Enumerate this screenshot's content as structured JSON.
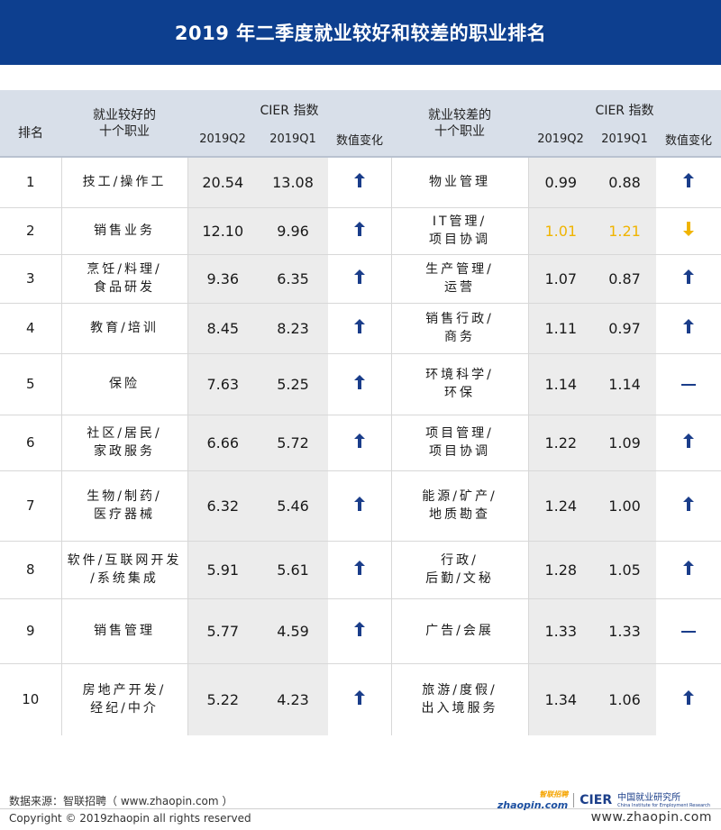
{
  "title": "2019 年二季度就业较好和较差的职业排名",
  "header": {
    "rank": "排名",
    "good_label_1": "就业较好的",
    "good_label_2": "十个职业",
    "bad_label_1": "就业较差的",
    "bad_label_2": "十个职业",
    "cier_index": "CIER 指数",
    "q2": "2019Q2",
    "q1": "2019Q1",
    "change": "数值变化"
  },
  "rows": [
    {
      "rank": "1",
      "good": [
        "技工/操作工"
      ],
      "good_q2": "20.54",
      "good_q1": "13.08",
      "good_change": "up",
      "bad": [
        "物业管理"
      ],
      "bad_q2": "0.99",
      "bad_q1": "0.88",
      "bad_change": "up"
    },
    {
      "rank": "2",
      "good": [
        "销售业务"
      ],
      "good_q2": "12.10",
      "good_q1": "9.96",
      "good_change": "up",
      "bad": [
        "IT管理/",
        "项目协调"
      ],
      "bad_q2": "1.01",
      "bad_q1": "1.21",
      "bad_change": "down"
    },
    {
      "rank": "3",
      "good": [
        "烹饪/料理/",
        "食品研发"
      ],
      "good_q2": "9.36",
      "good_q1": "6.35",
      "good_change": "up",
      "bad": [
        "生产管理/",
        "运营"
      ],
      "bad_q2": "1.07",
      "bad_q1": "0.87",
      "bad_change": "up"
    },
    {
      "rank": "4",
      "good": [
        "教育/培训"
      ],
      "good_q2": "8.45",
      "good_q1": "8.23",
      "good_change": "up",
      "bad": [
        "销售行政/",
        "商务"
      ],
      "bad_q2": "1.11",
      "bad_q1": "0.97",
      "bad_change": "up"
    },
    {
      "rank": "5",
      "good": [
        "保险"
      ],
      "good_q2": "7.63",
      "good_q1": "5.25",
      "good_change": "up",
      "bad": [
        "环境科学/",
        "环保"
      ],
      "bad_q2": "1.14",
      "bad_q1": "1.14",
      "bad_change": "flat"
    },
    {
      "rank": "6",
      "good": [
        "社区/居民/",
        "家政服务"
      ],
      "good_q2": "6.66",
      "good_q1": "5.72",
      "good_change": "up",
      "bad": [
        "项目管理/",
        "项目协调"
      ],
      "bad_q2": "1.22",
      "bad_q1": "1.09",
      "bad_change": "up"
    },
    {
      "rank": "7",
      "good": [
        "生物/制药/",
        "医疗器械"
      ],
      "good_q2": "6.32",
      "good_q1": "5.46",
      "good_change": "up",
      "bad": [
        "能源/矿产/",
        "地质勘查"
      ],
      "bad_q2": "1.24",
      "bad_q1": "1.00",
      "bad_change": "up"
    },
    {
      "rank": "8",
      "good": [
        "软件/互联网开发",
        "/系统集成"
      ],
      "good_q2": "5.91",
      "good_q1": "5.61",
      "good_change": "up",
      "bad": [
        "行政/",
        "后勤/文秘"
      ],
      "bad_q2": "1.28",
      "bad_q1": "1.05",
      "bad_change": "up"
    },
    {
      "rank": "9",
      "good": [
        "销售管理"
      ],
      "good_q2": "5.77",
      "good_q1": "4.59",
      "good_change": "up",
      "bad": [
        "广告/会展"
      ],
      "bad_q2": "1.33",
      "bad_q1": "1.33",
      "bad_change": "flat"
    },
    {
      "rank": "10",
      "good": [
        "房地产开发/",
        "经纪/中介"
      ],
      "good_q2": "5.22",
      "good_q1": "4.23",
      "good_change": "up",
      "bad": [
        "旅游/度假/",
        "出入境服务"
      ],
      "bad_q2": "1.34",
      "bad_q1": "1.06",
      "bad_change": "up"
    }
  ],
  "colors": {
    "title_bg": "#0d3f8f",
    "header_bg": "#d8dfe9",
    "arrow_up": "#1a3d8a",
    "arrow_down": "#f0b400",
    "highlight_text": "#f0b400"
  },
  "footer": {
    "source": "数据来源：智联招聘（ www.zhaopin.com ）",
    "copyright": "Copyright © 2019zhaopin all rights reserved",
    "url": "www.zhaopin.com",
    "zl_logo_top": "智联招聘",
    "zl_logo_bottom": "zhaopin.com",
    "cier_logo": "CIER",
    "cier_cn": "中国就业研究所",
    "cier_en": "China Institute for Employment Research"
  }
}
